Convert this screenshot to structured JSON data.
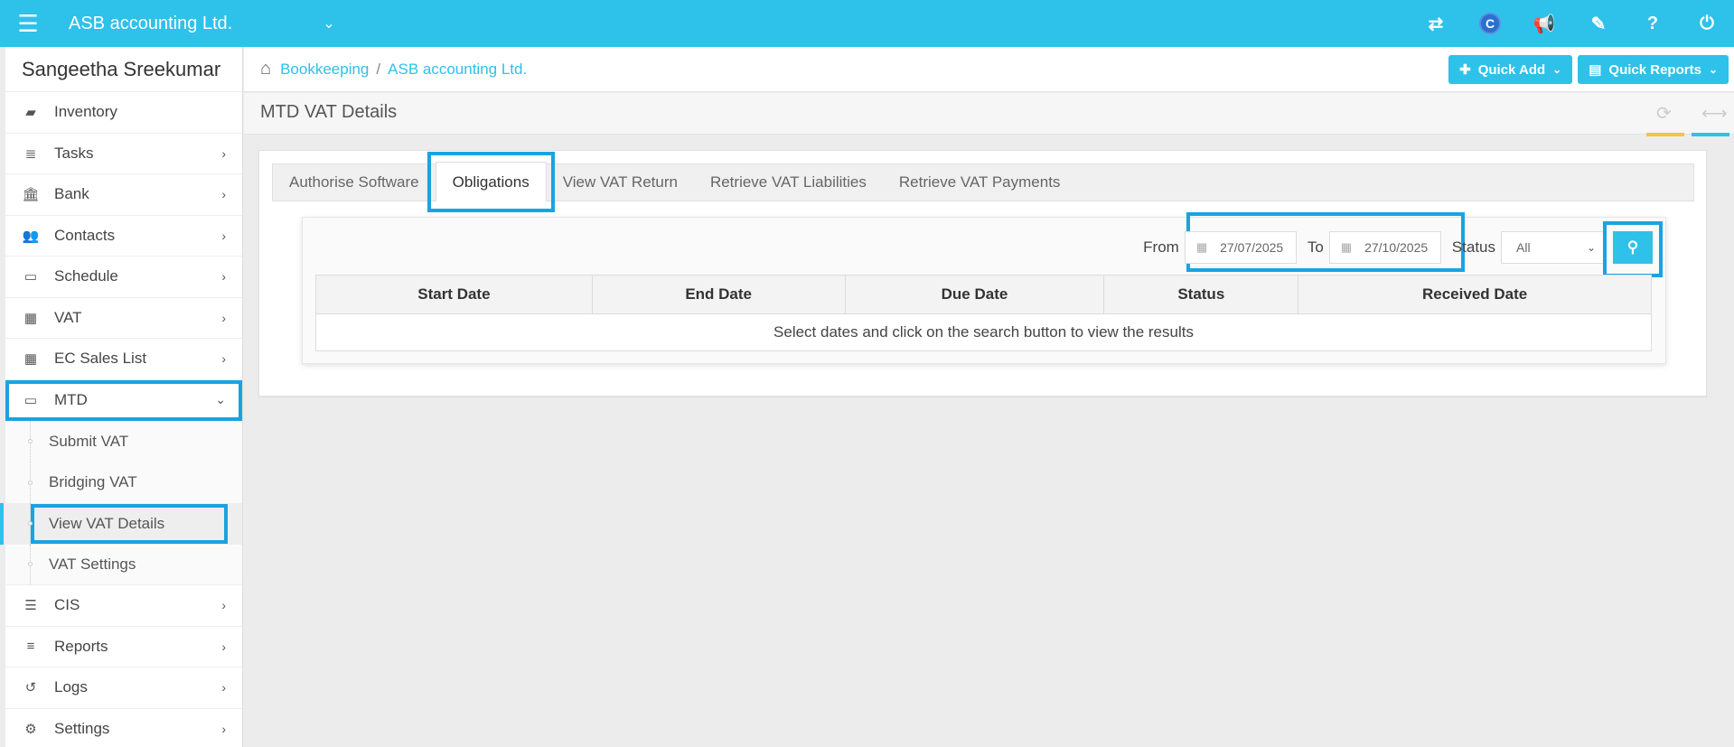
{
  "topbar": {
    "company": "ASB accounting Ltd.",
    "icons": [
      "transfer-icon",
      "c-logo-icon",
      "megaphone-icon",
      "ticket-icon",
      "help-icon",
      "power-icon"
    ],
    "c_logo_text": "C"
  },
  "sidebar": {
    "user_name": "Sangeetha Sreekumar",
    "items": [
      {
        "label": "Inventory",
        "icon": "truck-icon"
      },
      {
        "label": "Tasks",
        "icon": "tasks-icon"
      },
      {
        "label": "Bank",
        "icon": "bank-icon"
      },
      {
        "label": "Contacts",
        "icon": "users-icon"
      },
      {
        "label": "Schedule",
        "icon": "calendar-icon"
      },
      {
        "label": "VAT",
        "icon": "calculator-icon"
      },
      {
        "label": "EC Sales List",
        "icon": "calculator-icon"
      },
      {
        "label": "MTD",
        "icon": "calendar-icon"
      }
    ],
    "mtd_sub": [
      {
        "label": "Submit VAT"
      },
      {
        "label": "Bridging VAT"
      },
      {
        "label": "View VAT Details"
      },
      {
        "label": "VAT Settings"
      }
    ],
    "items_after": [
      {
        "label": "CIS",
        "icon": "indent-icon"
      },
      {
        "label": "Reports",
        "icon": "list-icon"
      },
      {
        "label": "Logs",
        "icon": "history-icon"
      },
      {
        "label": "Settings",
        "icon": "cogs-icon"
      }
    ]
  },
  "breadcrumb": {
    "items": [
      "Bookkeeping",
      "ASB accounting Ltd."
    ],
    "separator": "/"
  },
  "quick": {
    "add_label": "Quick Add",
    "reports_label": "Quick Reports"
  },
  "page": {
    "title": "MTD VAT Details"
  },
  "tabs": [
    "Authorise Software",
    "Obligations",
    "View VAT Return",
    "Retrieve VAT Liabilities",
    "Retrieve VAT Payments"
  ],
  "filter": {
    "from_label": "From",
    "from_value": "27/07/2025",
    "to_label": "To",
    "to_value": "27/10/2025",
    "status_label": "Status",
    "status_value": "All"
  },
  "table": {
    "headers": [
      "Start Date",
      "End Date",
      "Due Date",
      "Status",
      "Received Date"
    ],
    "empty_message": "Select dates and click on the search button to view the results"
  },
  "colors": {
    "accent": "#2ec1ea",
    "highlight": "#1aa3e0"
  }
}
